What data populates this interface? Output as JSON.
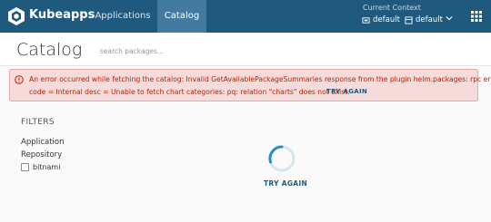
{
  "topbar": {
    "brand": "Kubeapps",
    "nav": [
      {
        "label": "Applications",
        "active": false
      },
      {
        "label": "Catalog",
        "active": true
      }
    ],
    "context": {
      "title": "Current Context",
      "cluster": "default",
      "namespace": "default"
    },
    "colors": {
      "background": "#1f5a7e",
      "active_tab": "#447aa0"
    }
  },
  "page": {
    "title": "Catalog",
    "search_placeholder": "search packages..."
  },
  "alert": {
    "line1": "An error occurred while fetching the catalog: Invalid GetAvailablePackageSummaries response from the plugin helm.packages: rpc error:",
    "line2": "code = Internal desc = Unable to fetch chart categories: pq: relation \"charts\" does not exist.",
    "retry_label": "TRY AGAIN",
    "colors": {
      "background": "#f5dbd9",
      "text": "#c21d00"
    }
  },
  "filters": {
    "title": "FILTERS",
    "groups": [
      {
        "label": "Application"
      },
      {
        "label": "Repository",
        "options": [
          {
            "label": "bitnami",
            "checked": false
          }
        ]
      }
    ]
  },
  "main": {
    "retry_label": "TRY AGAIN"
  }
}
